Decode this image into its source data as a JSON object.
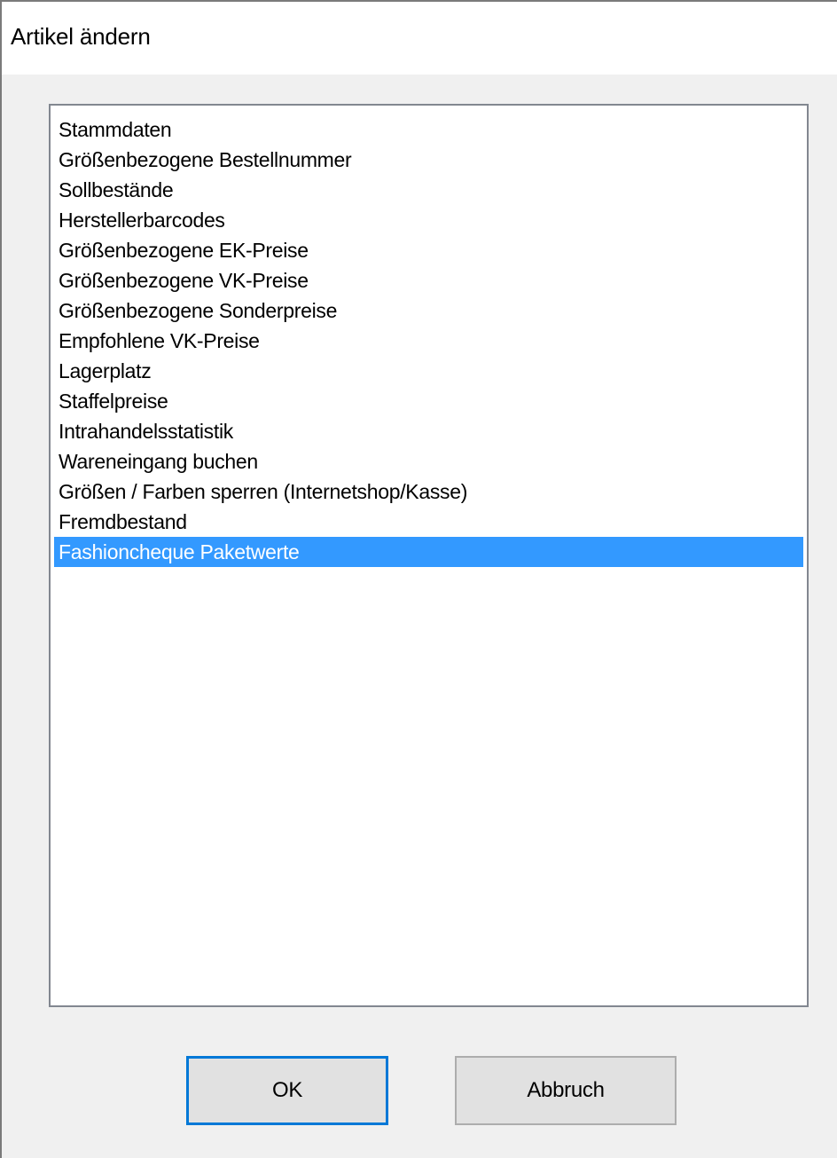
{
  "window": {
    "title": "Artikel ändern"
  },
  "list": {
    "items": [
      "Stammdaten",
      "Größenbezogene Bestellnummer",
      "Sollbestände",
      "Herstellerbarcodes",
      "Größenbezogene EK-Preise",
      "Größenbezogene VK-Preise",
      "Größenbezogene Sonderpreise",
      "Empfohlene VK-Preise",
      "Lagerplatz",
      "Staffelpreise",
      "Intrahandelsstatistik",
      "Wareneingang buchen",
      "Größen / Farben sperren (Internetshop/Kasse)",
      "Fremdbestand",
      "Fashioncheque Paketwerte"
    ],
    "selected_index": 14
  },
  "buttons": {
    "ok_label": "OK",
    "cancel_label": "Abbruch"
  },
  "colors": {
    "selection": "#3399ff",
    "default_button_border": "#0078d7",
    "dialog_background": "#f0f0f0"
  }
}
